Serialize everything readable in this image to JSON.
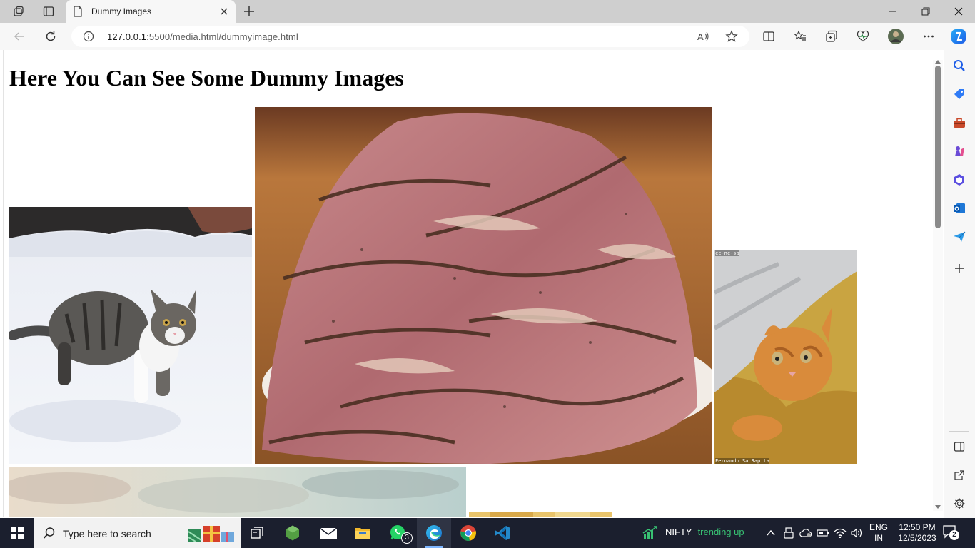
{
  "browser": {
    "tab": {
      "title": "Dummy Images"
    },
    "url": {
      "host": "127.0.0.1",
      "path": ":5500/media.html/dummyimage.html"
    }
  },
  "page": {
    "heading": "Here You Can See Some Dummy Images",
    "image_labels": {
      "cat_under_blanket_tag": "cc-nc-sa",
      "cat_under_blanket_credit": "Fernando Sa Rapita"
    }
  },
  "taskbar": {
    "search_placeholder": "Type here to search",
    "whatsapp_badge": "3",
    "nifty_label": "NIFTY",
    "nifty_trend": "trending up",
    "lang_line1": "ENG",
    "lang_line2": "IN",
    "time": "12:50 PM",
    "date": "12/5/2023",
    "notifications_badge": "2"
  },
  "colors": {
    "accent": "#0078d4",
    "trend_green": "#38c173",
    "taskbar_bg": "#1b1f2e"
  }
}
